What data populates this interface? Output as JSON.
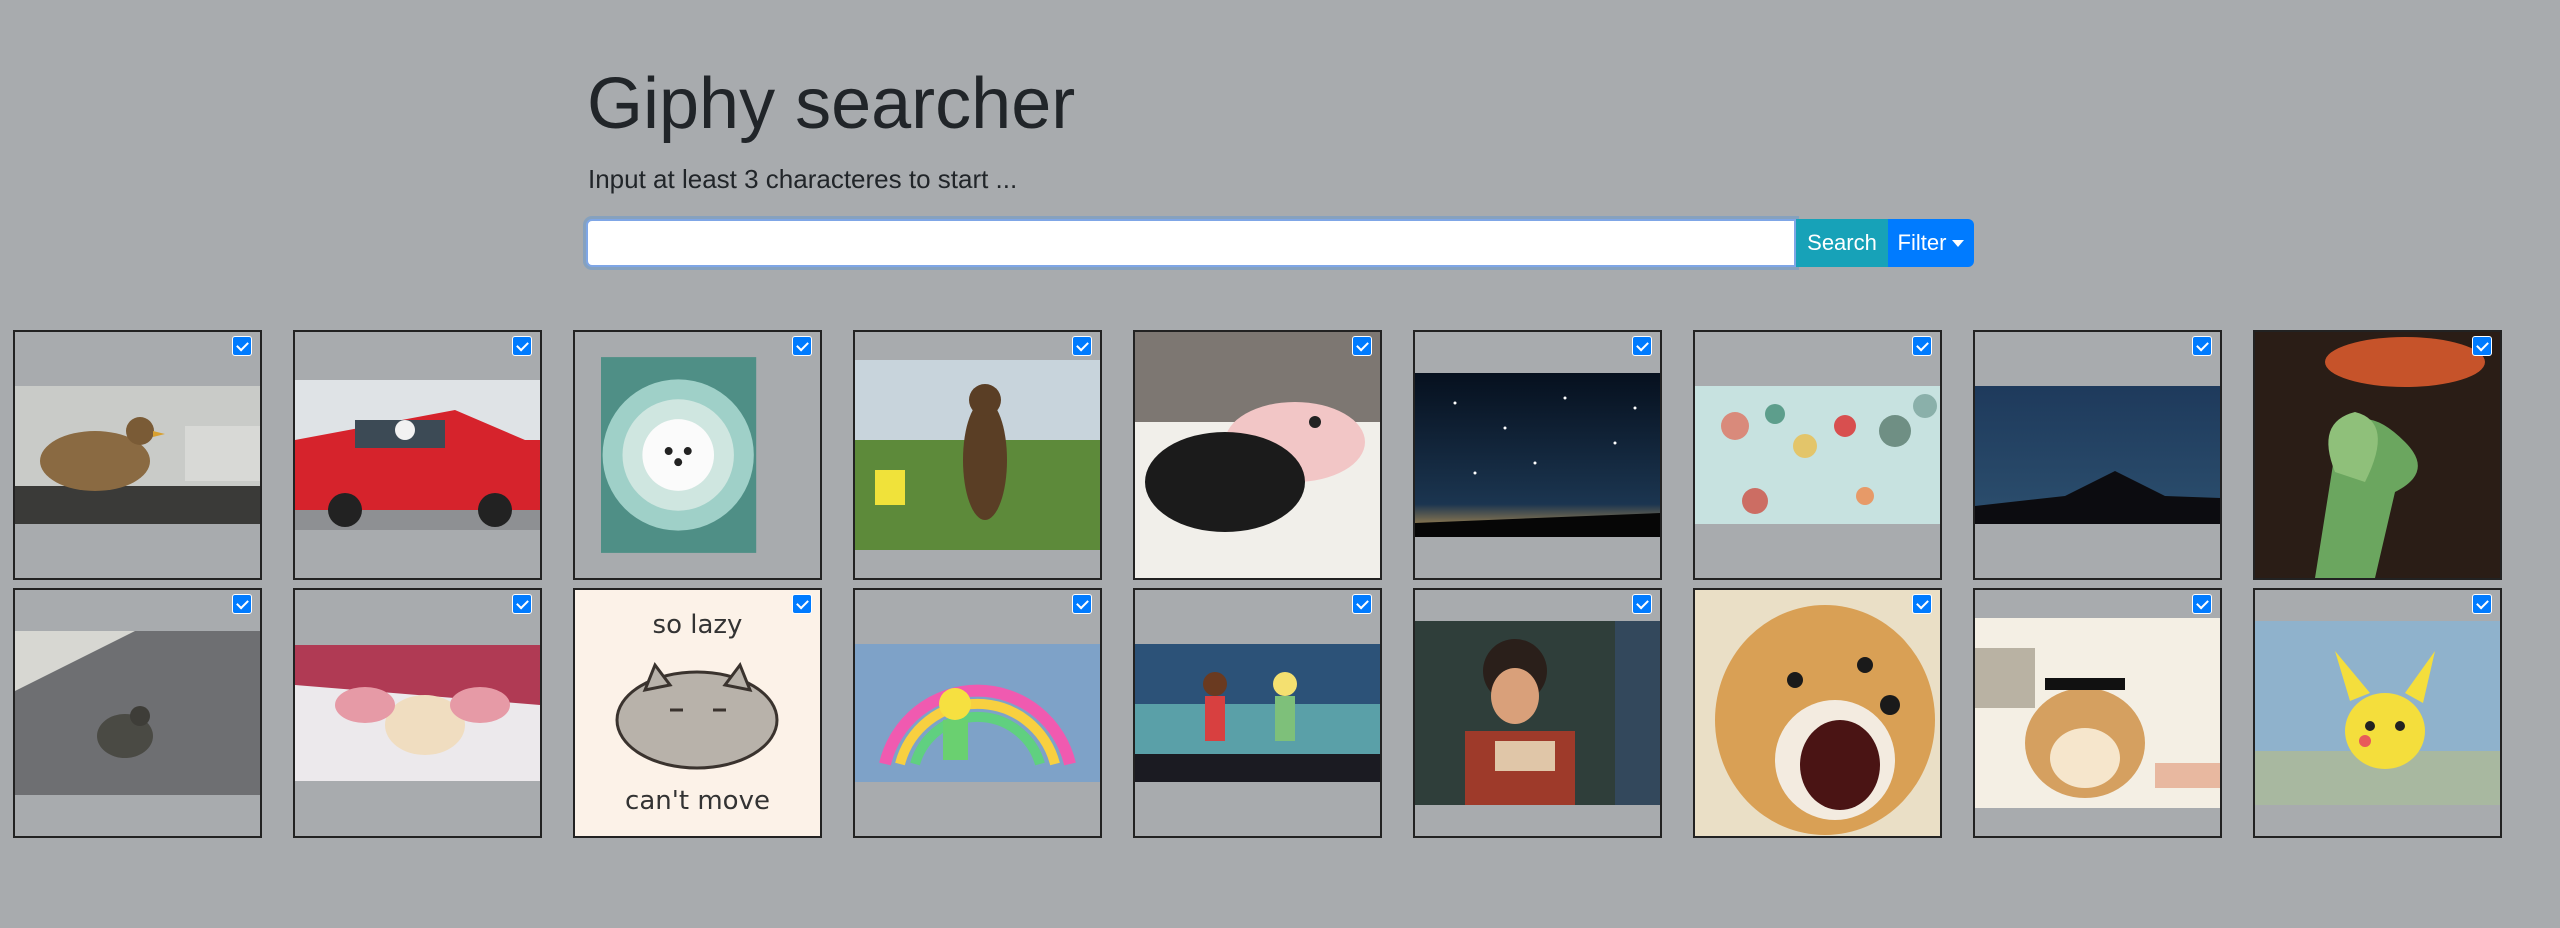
{
  "header": {
    "title": "Giphy searcher",
    "subtitle": "Input at least 3 characteres to start ..."
  },
  "search": {
    "value": "",
    "button_label": "Search",
    "filter_label": "Filter"
  },
  "gifs": [
    {
      "description": "chicken on car dashboard",
      "selected": true
    },
    {
      "description": "dog driving red car",
      "selected": true
    },
    {
      "description": "fluffy white pomeranian in bowl",
      "selected": true
    },
    {
      "description": "bear standing in grass",
      "selected": true
    },
    {
      "description": "black cat and piglet cuddling",
      "selected": true
    },
    {
      "description": "starry night sky",
      "selected": true
    },
    {
      "description": "colorful balloons in sky",
      "selected": true
    },
    {
      "description": "night sky over mountain",
      "selected": true
    },
    {
      "description": "chameleon catching food",
      "selected": true
    },
    {
      "description": "small bird on mesh",
      "selected": true
    },
    {
      "description": "hands holding small bird",
      "selected": true
    },
    {
      "description": "pusheen cat",
      "selected": true,
      "caption_top": "so lazy",
      "caption_bottom": "can't move"
    },
    {
      "description": "cartoon rainbow girl",
      "selected": true
    },
    {
      "description": "cartoon kids dancing",
      "selected": true
    },
    {
      "description": "anime fighter",
      "selected": true
    },
    {
      "description": "doge shiba barking",
      "selected": true
    },
    {
      "description": "shiba with sunglasses",
      "selected": true
    },
    {
      "description": "cartoon pichu",
      "selected": true
    }
  ],
  "colors": {
    "background": "#a8abae",
    "search_button": "#17a2b8",
    "filter_button": "#007bff",
    "checkbox": "#007bff"
  }
}
